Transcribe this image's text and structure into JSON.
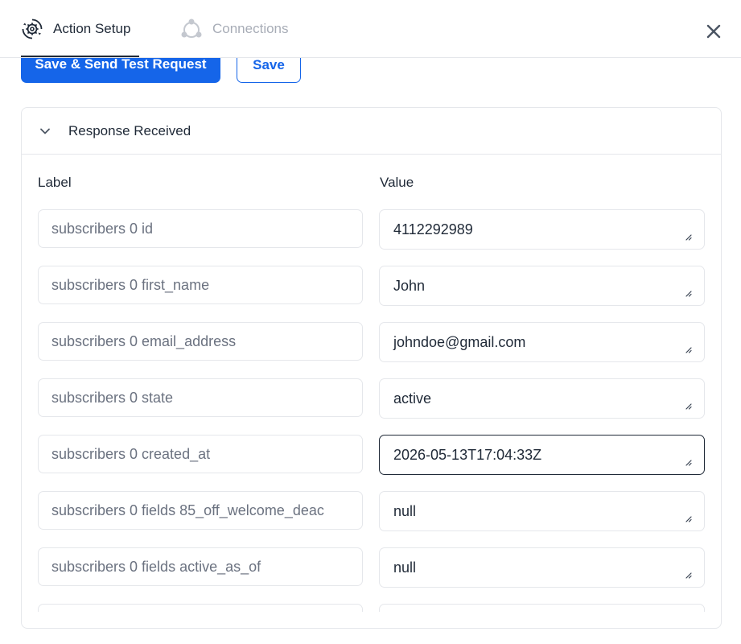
{
  "header": {
    "tabs": [
      {
        "label": "Action Setup",
        "icon": "gear-cycle-icon",
        "active": true
      },
      {
        "label": "Connections",
        "icon": "connections-icon",
        "active": false
      }
    ],
    "close_icon": "close-icon"
  },
  "toolbar": {
    "save_send_label": "Save & Send Test Request",
    "save_label": "Save"
  },
  "response_panel": {
    "title": "Response Received",
    "label_column": "Label",
    "value_column": "Value",
    "rows": [
      {
        "label": "subscribers 0 id",
        "value": "4112292989"
      },
      {
        "label": "subscribers 0 first_name",
        "value": "John"
      },
      {
        "label": "subscribers 0 email_address",
        "value": "johndoe@gmail.com"
      },
      {
        "label": "subscribers 0 state",
        "value": "active"
      },
      {
        "label": "subscribers 0 created_at",
        "value": "2026-05-13T17:04:33Z"
      },
      {
        "label": "subscribers 0 fields 85_off_welcome_deac",
        "value": "null"
      },
      {
        "label": "subscribers 0 fields active_as_of",
        "value": "null"
      },
      {
        "label": "",
        "value": ""
      }
    ]
  },
  "colors": {
    "primary": "#1565e9",
    "border": "#e5e7eb",
    "text": "#1f2937",
    "muted": "#6b7280"
  }
}
